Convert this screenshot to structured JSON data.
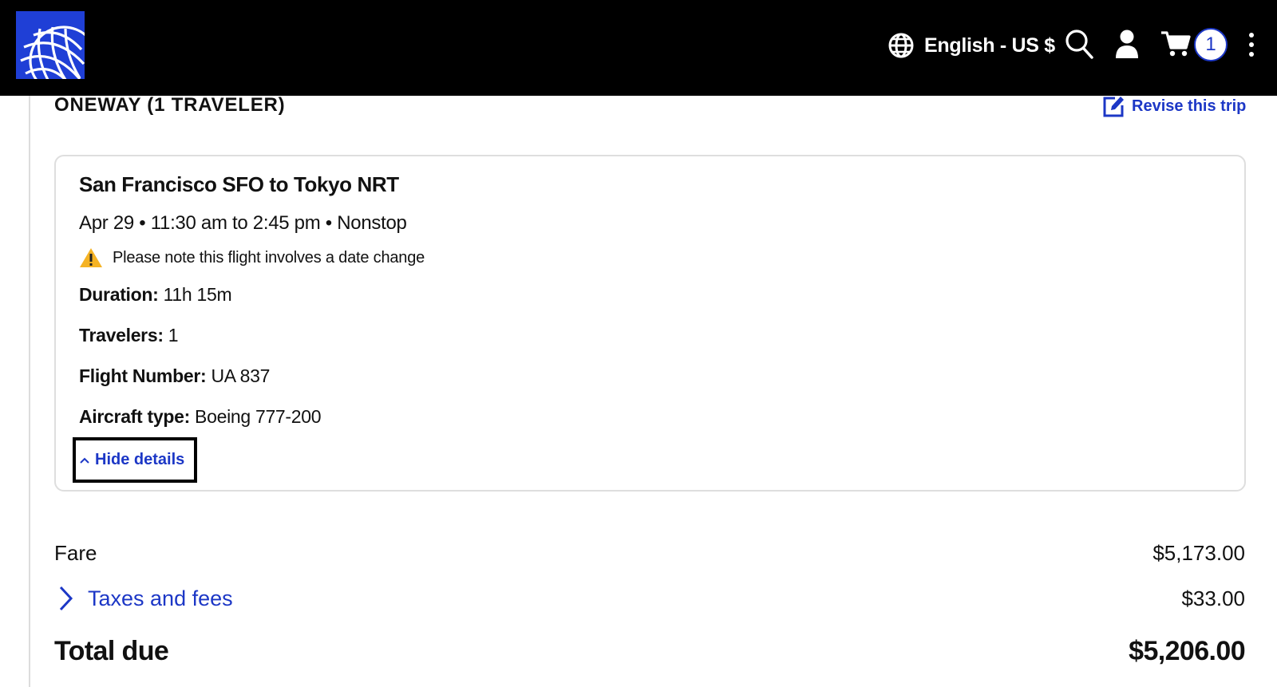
{
  "header": {
    "logo_icon": "united-globe-logo",
    "language_label": "English - US $",
    "language_icon": "globe-icon",
    "search_icon": "search-icon",
    "account_icon": "user-icon",
    "cart_icon": "cart-icon",
    "cart_count": "1",
    "more_icon": "more-vertical-icon"
  },
  "trip": {
    "heading": "ONEWAY (1 TRAVELER)",
    "revise_label": "Revise this trip",
    "revise_icon": "edit-icon"
  },
  "flight": {
    "route": "San Francisco SFO to Tokyo NRT",
    "schedule": "Apr 29 • 11:30 am to 2:45 pm • Nonstop",
    "warning_icon": "warning-icon",
    "warning_text": "Please note this flight involves a date change",
    "duration_label": "Duration:",
    "duration_value": "11h 15m",
    "travelers_label": "Travelers:",
    "travelers_value": "1",
    "flight_number_label": "Flight Number:",
    "flight_number_value": "UA 837",
    "aircraft_label": "Aircraft type:",
    "aircraft_value": "Boeing 777-200",
    "toggle_label": "Hide details",
    "toggle_icon": "chevron-up-icon"
  },
  "pricing": {
    "fare_label": "Fare",
    "fare_value": "$5,173.00",
    "taxes_label": "Taxes and fees",
    "taxes_icon": "chevron-right-icon",
    "taxes_value": "$33.00",
    "total_label": "Total due",
    "total_value": "$5,206.00"
  },
  "colors": {
    "header_bg": "#000000",
    "logo_bg": "#1f3fd6",
    "link": "#1c37c6",
    "warning": "#f5b324",
    "text": "#111111",
    "card_border": "#dedede"
  }
}
